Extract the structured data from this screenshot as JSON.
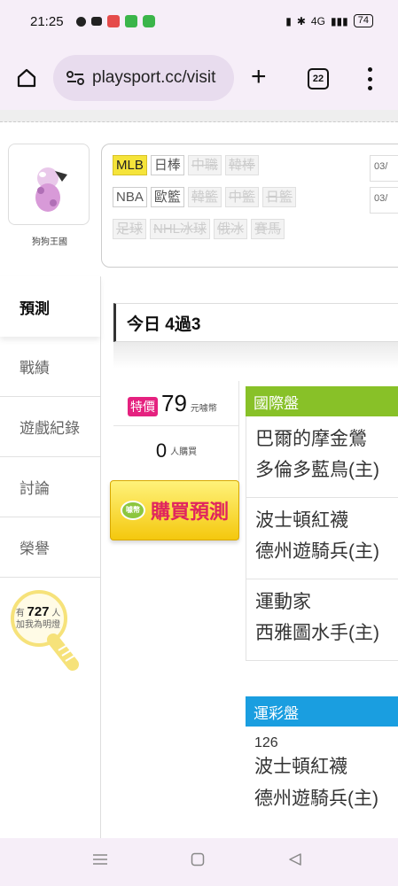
{
  "status": {
    "time": "21:25",
    "right_text": "4G",
    "battery": "74"
  },
  "browser": {
    "url": "playsport.cc/visit",
    "tab_count": "22"
  },
  "profile": {
    "name": "狗狗王國"
  },
  "leagues": {
    "row1": [
      {
        "label": "MLB",
        "state": "active"
      },
      {
        "label": "日棒",
        "state": "normal"
      },
      {
        "label": "中職",
        "state": "disabled"
      },
      {
        "label": "韓棒",
        "state": "disabled"
      }
    ],
    "row2": [
      {
        "label": "NBA",
        "state": "normal"
      },
      {
        "label": "歐籃",
        "state": "normal"
      },
      {
        "label": "韓籃",
        "state": "disabled"
      },
      {
        "label": "中籃",
        "state": "disabled"
      },
      {
        "label": "日籃",
        "state": "disabled"
      }
    ],
    "row3": [
      {
        "label": "足球",
        "state": "disabled"
      },
      {
        "label": "NHL冰球",
        "state": "disabled"
      },
      {
        "label": "俄冰",
        "state": "disabled"
      },
      {
        "label": "賽馬",
        "state": "disabled"
      }
    ],
    "dates": [
      "03/",
      "03/"
    ]
  },
  "sidenav": {
    "items": [
      "預測",
      "戰績",
      "遊戲紀錄",
      "討論",
      "榮譽"
    ]
  },
  "fans": {
    "prefix": "有",
    "count": "727",
    "unit": "人",
    "suffix": "加我為明燈"
  },
  "today": {
    "label": "今日",
    "record": "4過3"
  },
  "price": {
    "tag": "特價",
    "value": "79",
    "unit": "元噱幣",
    "buyers": "0",
    "buyers_unit": "人購買",
    "buy_button": "購買預測",
    "buy_icon_text": "噱幣"
  },
  "intl": {
    "header": "國際盤",
    "games": [
      {
        "away": "巴爾的摩金鶯",
        "home": "多倫多藍鳥(主)"
      },
      {
        "away": "波士頓紅襪",
        "home": "德州遊騎兵(主)"
      },
      {
        "away": "運動家",
        "home": "西雅圖水手(主)"
      }
    ]
  },
  "lottery": {
    "header": "運彩盤",
    "number": "126",
    "away": "波士頓紅襪",
    "home": "德州遊騎兵(主)"
  },
  "colors": {
    "accent_green": "#88c128",
    "accent_blue": "#1a9ee0",
    "special_pink": "#e5217f",
    "active_yellow": "#f5e43a"
  }
}
